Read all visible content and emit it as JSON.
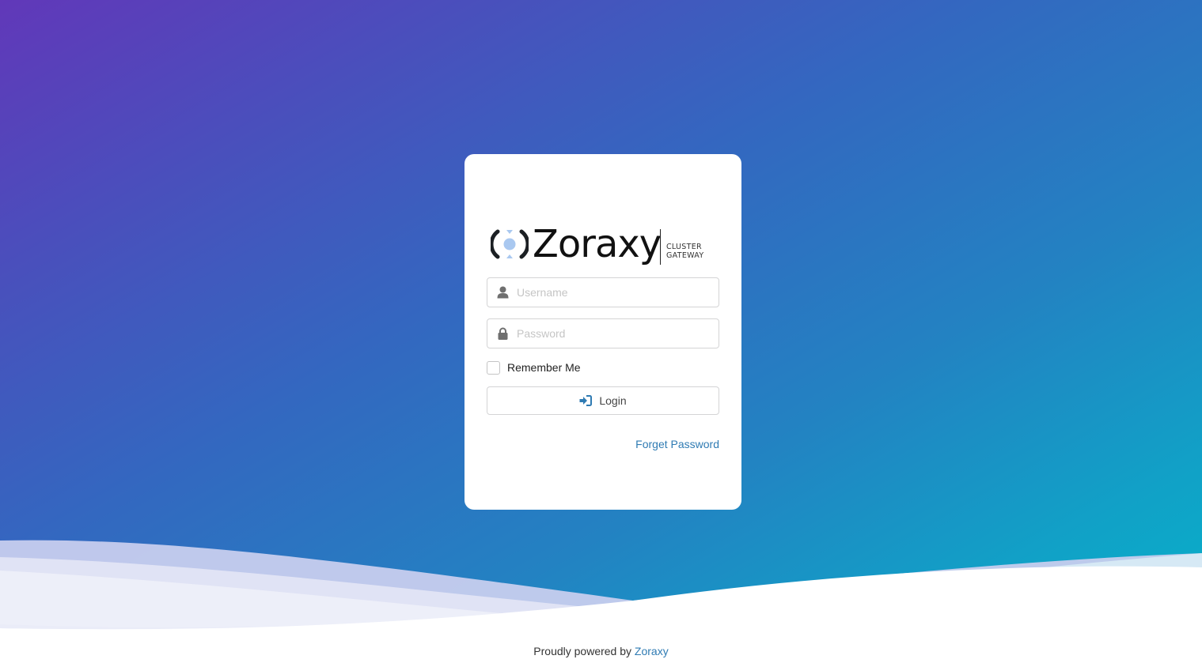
{
  "brand": {
    "name": "Zoraxy",
    "tagline_line1": "CLUSTER",
    "tagline_line2": "GATEWAY"
  },
  "login_form": {
    "username": {
      "value": "",
      "placeholder": "Username",
      "icon": "user-icon"
    },
    "password": {
      "value": "",
      "placeholder": "Password",
      "icon": "lock-icon"
    },
    "remember_me": {
      "label": "Remember Me",
      "checked": false
    },
    "submit": {
      "label": "Login",
      "icon": "sign-in-icon"
    },
    "forget_password": "Forget Password"
  },
  "footer": {
    "text": "Proudly powered by ",
    "link": "Zoraxy"
  },
  "colors": {
    "background_gradient": [
      "#6138b9",
      "#3368c0",
      "#05b3c9"
    ],
    "link": "#2f7bb3",
    "card": "#ffffff"
  }
}
